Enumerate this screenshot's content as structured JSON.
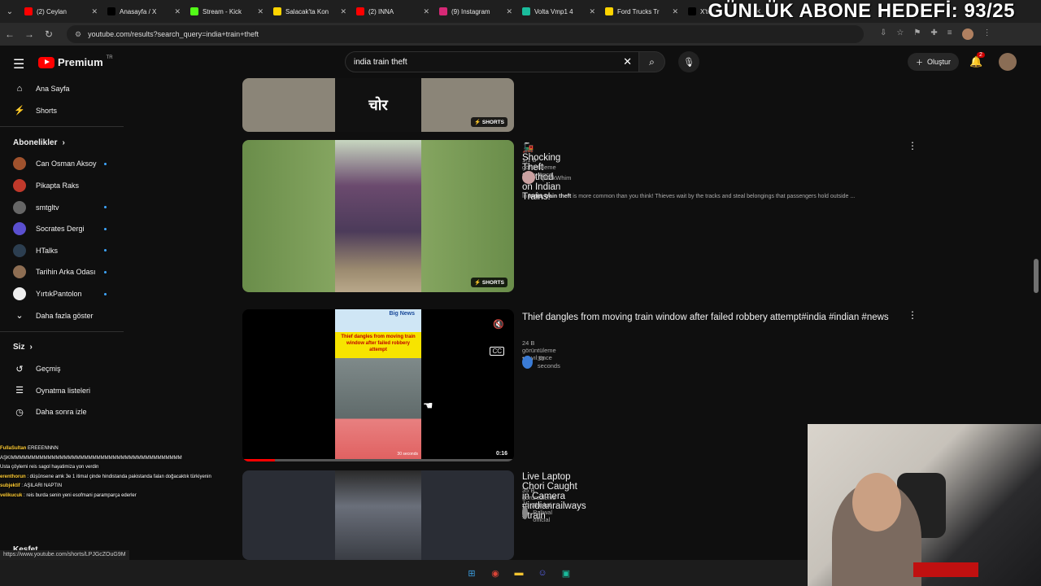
{
  "browser": {
    "tabs": [
      {
        "title": "(2) Ceylan",
        "color": "#ff0000"
      },
      {
        "title": "Anasayfa / X",
        "color": "#000000"
      },
      {
        "title": "Stream - Kick",
        "color": "#53fc18"
      },
      {
        "title": "Salacak'ta Kon",
        "color": "#ffd400"
      },
      {
        "title": "(2) INNA",
        "color": "#ff0000"
      },
      {
        "title": "(9) Instagram",
        "color": "#d62976"
      },
      {
        "title": "Volta Vmp1 4",
        "color": "#1abc9c"
      },
      {
        "title": "Ford Trucks Tr",
        "color": "#ffd400"
      },
      {
        "title": "X'te",
        "color": "#000000"
      }
    ],
    "url": "youtube.com/results?search_query=india+train+theft",
    "status_url": "https://www.youtube.com/shorts/LPJGcZOuG9M"
  },
  "overlay_banner": "GÜNLÜK ABONE HEDEFİ: 93/25",
  "header": {
    "logo_word": "Premium",
    "logo_region": "TR",
    "search_value": "india train theft",
    "create_label": "Oluştur",
    "notif_count": "2"
  },
  "sidebar": {
    "top": [
      {
        "label": "Ana Sayfa",
        "icon": "home-icon",
        "glyph": "⌂"
      },
      {
        "label": "Shorts",
        "icon": "shorts-icon",
        "glyph": "⚡"
      }
    ],
    "subs_header": "Abonelikler",
    "subs": [
      {
        "label": "Can Osman Aksoy",
        "color": "#a0522d",
        "dot": true
      },
      {
        "label": "Pikapta Raks",
        "color": "#c0392b",
        "dot": false
      },
      {
        "label": "smtgltv",
        "color": "#666666",
        "dot": true
      },
      {
        "label": "Socrates Dergi",
        "color": "#5a4fcf",
        "dot": true
      },
      {
        "label": "HTalks",
        "color": "#2c3e50",
        "dot": true
      },
      {
        "label": "Tarihin Arka Odası",
        "color": "#8e6e53",
        "dot": true
      },
      {
        "label": "YırtıkPantolon",
        "color": "#eeeeee",
        "dot": true
      }
    ],
    "show_more": "Daha fazla göster",
    "you_header": "Siz",
    "you_items": [
      {
        "label": "Geçmiş",
        "glyph": "↺",
        "icon": "history-icon"
      },
      {
        "label": "Oynatma listeleri",
        "glyph": "☰",
        "icon": "playlist-icon"
      },
      {
        "label": "Daha sonra izle",
        "glyph": "◷",
        "icon": "watch-later-icon"
      }
    ],
    "explore_header": "Keşfet"
  },
  "chat": [
    {
      "user": "FullaSultan",
      "text": "EREEENNNN"
    },
    {
      "user": "",
      "text": "AŞKIMMMMMMMMMMMMMMMMMMMMMMMMMMMMMMMMMMMMMMMMMM"
    },
    {
      "user": "",
      "text": "Usta çöylemi reis sagol hayatimiza yon verdin"
    },
    {
      "user": "erenthorun",
      "text": ": düşünsene amk 3e 1 itimal çinde hindistanda pakistanda falan doğacaktık türkiyenin bokunu yertz bokunu"
    },
    {
      "user": "subjektif",
      "text": ": AŞILARI NAPTIN"
    },
    {
      "user": "velikucuk",
      "text": ": reis burda senin yeni esofmani paramparça ederler"
    }
  ],
  "results": [
    {
      "title": "",
      "badge": "SHORTS",
      "thumb_text": "चोर"
    },
    {
      "emoji": "🚂",
      "title": "Shocking Theft Method on Indian Trains!",
      "meta": "1,1 B görüntüleme • 4 ay önce",
      "channel": "QuickWhim",
      "desc_pre": "In ",
      "desc_bold": "India, train theft",
      "desc_post": " is more common than you think! Thieves wait by the tracks and steal belongings that passengers hold outside ...",
      "badge": "SHORTS"
    },
    {
      "title": "Thief dangles from moving train window after failed robbery attempt#india #indian #news",
      "meta": "24 B görüntüleme • 2 yıl önce",
      "channel": "30 seconds",
      "duration": "0:16",
      "thumb_header": "Big News",
      "thumb_caption": "Thief dangles from moving train window after failed robbery attempt",
      "thumb_footer": "30 seconds",
      "progress": 0.12
    },
    {
      "title": "Live Laptop Chori Caught in Camera #indianrailways #train",
      "meta": "35 B görüntüleme • 3 yıl önce",
      "channel": "Pankaj Paliwal official"
    }
  ],
  "taskbar": [
    {
      "icon": "windows-icon",
      "color": "#3a9bdc",
      "glyph": "⊞"
    },
    {
      "icon": "chrome-icon",
      "color": "#db4437",
      "glyph": "◉"
    },
    {
      "icon": "files-icon",
      "color": "#f4c430",
      "glyph": "▬"
    },
    {
      "icon": "discord-icon",
      "color": "#5865f2",
      "glyph": "☺"
    },
    {
      "icon": "app-icon",
      "color": "#1abc9c",
      "glyph": "▣"
    }
  ]
}
